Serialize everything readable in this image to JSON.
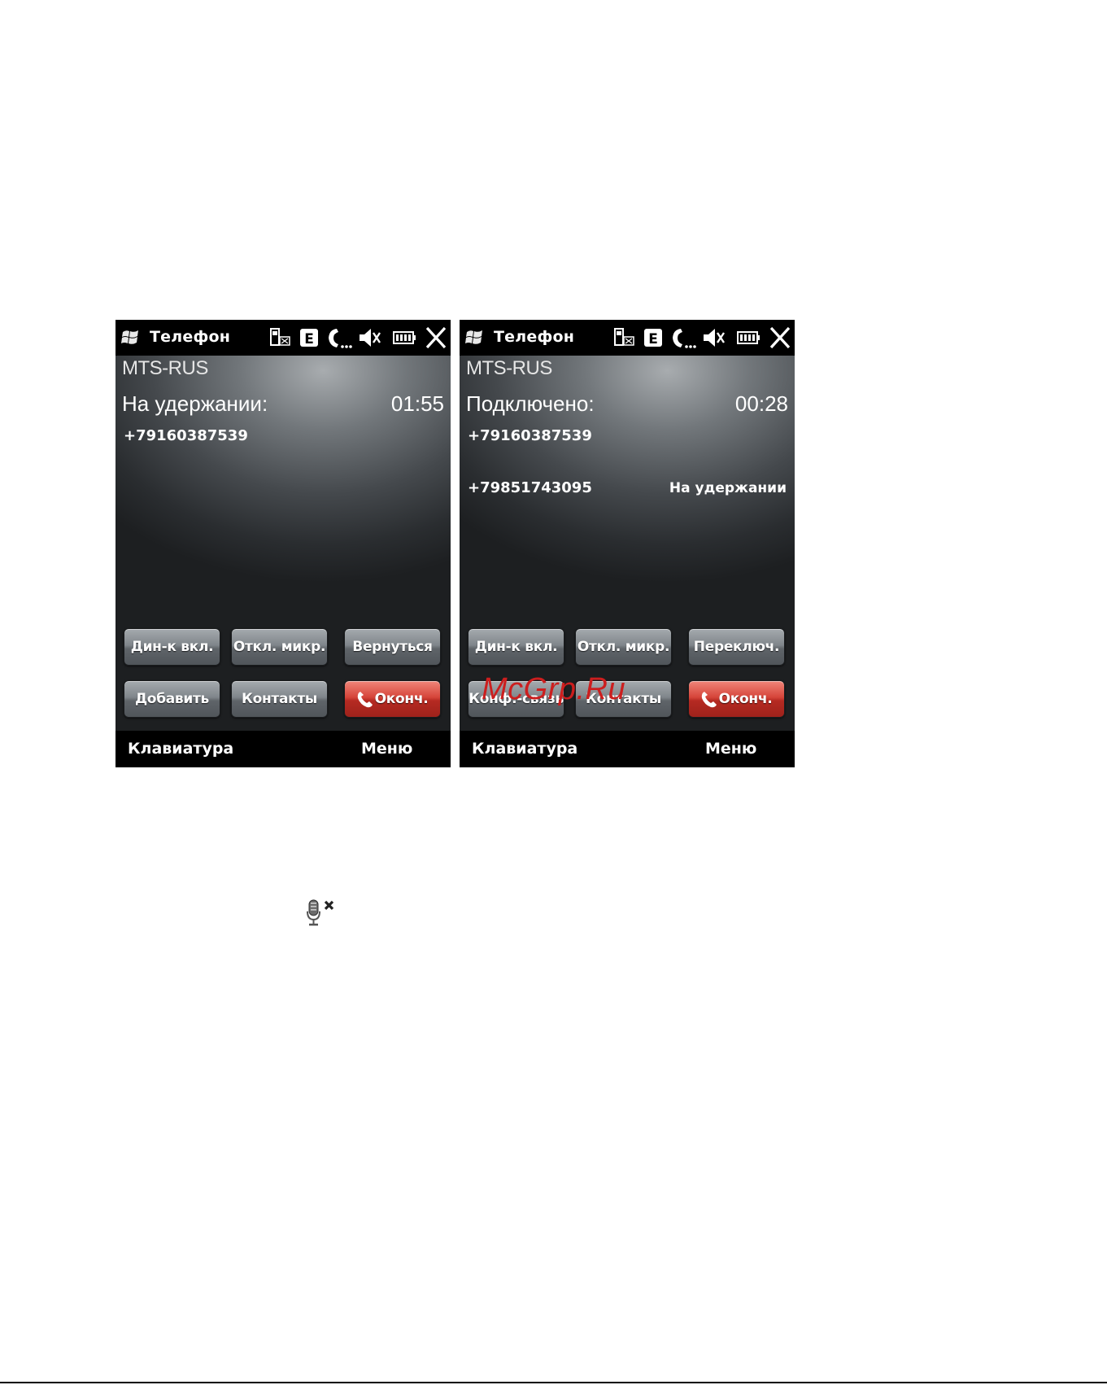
{
  "screens": [
    {
      "title": "Телефон",
      "operator": "MTS-RUS",
      "call_state": "На удержании:",
      "timer": "01:55",
      "calls": [
        {
          "number": "+79160387539",
          "status": ""
        }
      ],
      "buttons": {
        "speaker": "Дин-к вкл.",
        "mute": "Откл. микр.",
        "third": "Вернуться",
        "add": "Добавить",
        "contacts": "Контакты",
        "end": "Оконч."
      },
      "softkeys": {
        "left": "Клавиатура",
        "right": "Меню"
      }
    },
    {
      "title": "Телефон",
      "operator": "MTS-RUS",
      "call_state": "Подключено:",
      "timer": "00:28",
      "calls": [
        {
          "number": "+79160387539",
          "status": ""
        },
        {
          "number": "+79851743095",
          "status": "На удержании"
        }
      ],
      "buttons": {
        "speaker": "Дин-к вкл.",
        "mute": "Откл. микр.",
        "third": "Переключ.",
        "add": "Конф.-связь",
        "contacts": "Контакты",
        "end": "Оконч."
      },
      "softkeys": {
        "left": "Клавиатура",
        "right": "Меню"
      }
    }
  ],
  "status_icons": [
    "sim-signal-icon",
    "edge-icon",
    "call-active-icon",
    "speaker-muted-icon",
    "battery-icon",
    "close-icon"
  ],
  "watermark": "McGrp.Ru",
  "colors": {
    "title_bar": "#000000",
    "screen_bg": "#2a2d30",
    "button": "#80868b",
    "end_button": "#d6453a",
    "watermark": "#cc1e1e"
  }
}
